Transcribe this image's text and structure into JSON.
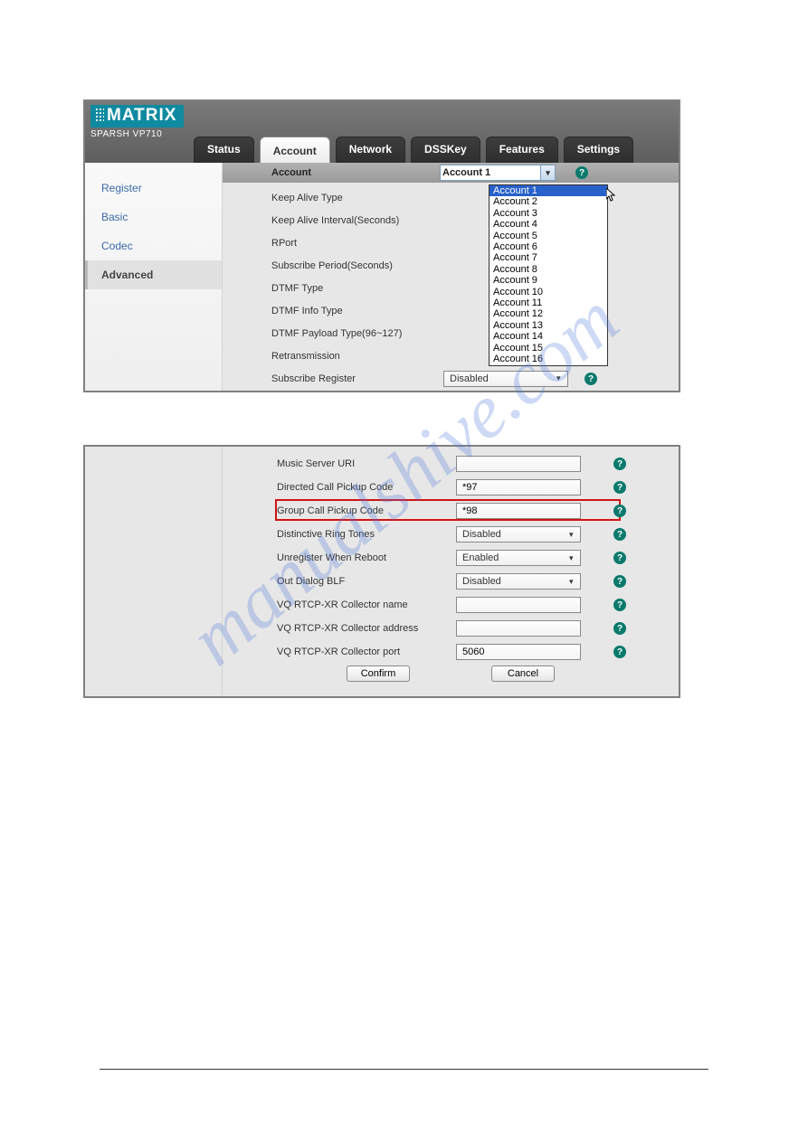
{
  "watermark": "manualshive.com",
  "brand": {
    "name": "MATRIX",
    "product": "SPARSH VP710"
  },
  "tabs": [
    "Status",
    "Account",
    "Network",
    "DSSKey",
    "Features",
    "Settings"
  ],
  "active_tab": "Account",
  "sidebar": {
    "items": [
      "Register",
      "Basic",
      "Codec",
      "Advanced"
    ],
    "active": "Advanced"
  },
  "p1": {
    "header_label": "Account",
    "account_select": "Account 1",
    "rows": [
      "Keep Alive Type",
      "Keep Alive Interval(Seconds)",
      "RPort",
      "Subscribe Period(Seconds)",
      "DTMF Type",
      "DTMF Info Type",
      "DTMF Payload Type(96~127)",
      "Retransmission",
      "Subscribe Register"
    ],
    "last_row_value": "Disabled",
    "dropdown": [
      "Account 1",
      "Account 2",
      "Account 3",
      "Account 4",
      "Account 5",
      "Account 6",
      "Account 7",
      "Account 8",
      "Account 9",
      "Account 10",
      "Account 11",
      "Account 12",
      "Account 13",
      "Account 14",
      "Account 15",
      "Account 16"
    ],
    "dropdown_highlight": "Account 1"
  },
  "p2": {
    "rows": [
      {
        "label": "Music Server URI",
        "type": "text",
        "value": ""
      },
      {
        "label": "Directed Call Pickup Code",
        "type": "text",
        "value": "*97"
      },
      {
        "label": "Group Call Pickup Code",
        "type": "text",
        "value": "*98",
        "highlight": true
      },
      {
        "label": "Distinctive Ring Tones",
        "type": "select",
        "value": "Disabled"
      },
      {
        "label": "Unregister When Reboot",
        "type": "select",
        "value": "Enabled"
      },
      {
        "label": "Out Dialog BLF",
        "type": "select",
        "value": "Disabled"
      },
      {
        "label": "VQ RTCP-XR Collector name",
        "type": "text",
        "value": ""
      },
      {
        "label": "VQ RTCP-XR Collector address",
        "type": "text",
        "value": ""
      },
      {
        "label": "VQ RTCP-XR Collector port",
        "type": "text",
        "value": "5060"
      }
    ],
    "buttons": {
      "confirm": "Confirm",
      "cancel": "Cancel"
    }
  },
  "help_glyph": "?"
}
